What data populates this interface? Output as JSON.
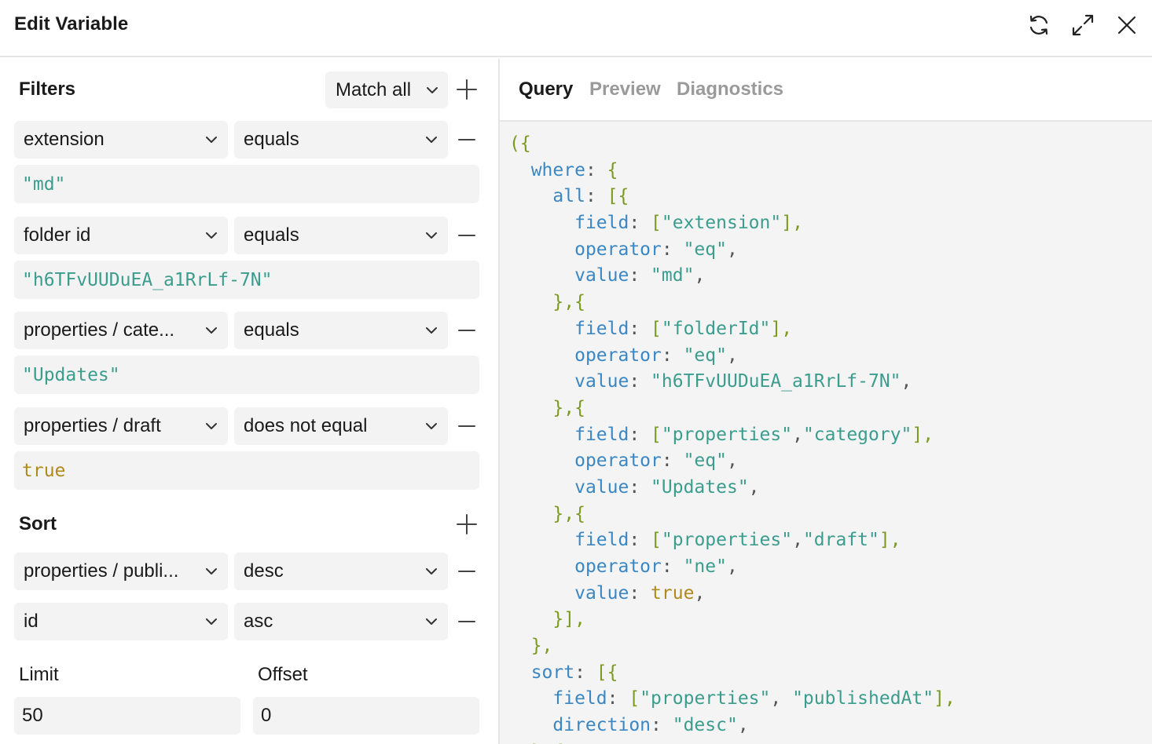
{
  "header": {
    "title": "Edit Variable",
    "icons": [
      "refresh-icon",
      "expand-icon",
      "close-icon"
    ]
  },
  "filters": {
    "title": "Filters",
    "match": "Match all",
    "rows": [
      {
        "field": "extension",
        "operator": "equals",
        "value": "\"md\"",
        "value_type": "string"
      },
      {
        "field": "folder id",
        "operator": "equals",
        "value": "\"h6TFvUUDuEA_a1RrLf-7N\"",
        "value_type": "string"
      },
      {
        "field": "properties / cate...",
        "operator": "equals",
        "value": "\"Updates\"",
        "value_type": "string"
      },
      {
        "field": "properties / draft",
        "operator": "does not equal",
        "value": "true",
        "value_type": "bool"
      }
    ]
  },
  "sort": {
    "title": "Sort",
    "rows": [
      {
        "field": "properties / publi...",
        "direction": "desc"
      },
      {
        "field": "id",
        "direction": "asc"
      }
    ]
  },
  "limit": {
    "label": "Limit",
    "value": "50"
  },
  "offset": {
    "label": "Offset",
    "value": "0"
  },
  "tabs": [
    {
      "label": "Query",
      "active": true
    },
    {
      "label": "Preview",
      "active": false
    },
    {
      "label": "Diagnostics",
      "active": false
    }
  ],
  "code_lines": [
    [
      [
        "p",
        "({"
      ]
    ],
    [
      [
        "c",
        "  "
      ],
      [
        "k",
        "where"
      ],
      [
        "c",
        ": "
      ],
      [
        "p",
        "{"
      ]
    ],
    [
      [
        "c",
        "    "
      ],
      [
        "k",
        "all"
      ],
      [
        "c",
        ": "
      ],
      [
        "p",
        "[{"
      ]
    ],
    [
      [
        "c",
        "      "
      ],
      [
        "k",
        "field"
      ],
      [
        "c",
        ": "
      ],
      [
        "p",
        "["
      ],
      [
        "s",
        "\"extension\""
      ],
      [
        "p",
        "],"
      ]
    ],
    [
      [
        "c",
        "      "
      ],
      [
        "k",
        "operator"
      ],
      [
        "c",
        ": "
      ],
      [
        "s",
        "\"eq\""
      ],
      [
        "c",
        ","
      ]
    ],
    [
      [
        "c",
        "      "
      ],
      [
        "k",
        "value"
      ],
      [
        "c",
        ": "
      ],
      [
        "s",
        "\"md\""
      ],
      [
        "c",
        ","
      ]
    ],
    [
      [
        "c",
        "    "
      ],
      [
        "p",
        "},{"
      ]
    ],
    [
      [
        "c",
        "      "
      ],
      [
        "k",
        "field"
      ],
      [
        "c",
        ": "
      ],
      [
        "p",
        "["
      ],
      [
        "s",
        "\"folderId\""
      ],
      [
        "p",
        "],"
      ]
    ],
    [
      [
        "c",
        "      "
      ],
      [
        "k",
        "operator"
      ],
      [
        "c",
        ": "
      ],
      [
        "s",
        "\"eq\""
      ],
      [
        "c",
        ","
      ]
    ],
    [
      [
        "c",
        "      "
      ],
      [
        "k",
        "value"
      ],
      [
        "c",
        ": "
      ],
      [
        "s",
        "\"h6TFvUUDuEA_a1RrLf-7N\""
      ],
      [
        "c",
        ","
      ]
    ],
    [
      [
        "c",
        "    "
      ],
      [
        "p",
        "},{"
      ]
    ],
    [
      [
        "c",
        "      "
      ],
      [
        "k",
        "field"
      ],
      [
        "c",
        ": "
      ],
      [
        "p",
        "["
      ],
      [
        "s",
        "\"properties\""
      ],
      [
        "c",
        ","
      ],
      [
        "s",
        "\"category\""
      ],
      [
        "p",
        "],"
      ]
    ],
    [
      [
        "c",
        "      "
      ],
      [
        "k",
        "operator"
      ],
      [
        "c",
        ": "
      ],
      [
        "s",
        "\"eq\""
      ],
      [
        "c",
        ","
      ]
    ],
    [
      [
        "c",
        "      "
      ],
      [
        "k",
        "value"
      ],
      [
        "c",
        ": "
      ],
      [
        "s",
        "\"Updates\""
      ],
      [
        "c",
        ","
      ]
    ],
    [
      [
        "c",
        "    "
      ],
      [
        "p",
        "},{"
      ]
    ],
    [
      [
        "c",
        "      "
      ],
      [
        "k",
        "field"
      ],
      [
        "c",
        ": "
      ],
      [
        "p",
        "["
      ],
      [
        "s",
        "\"properties\""
      ],
      [
        "c",
        ","
      ],
      [
        "s",
        "\"draft\""
      ],
      [
        "p",
        "],"
      ]
    ],
    [
      [
        "c",
        "      "
      ],
      [
        "k",
        "operator"
      ],
      [
        "c",
        ": "
      ],
      [
        "s",
        "\"ne\""
      ],
      [
        "c",
        ","
      ]
    ],
    [
      [
        "c",
        "      "
      ],
      [
        "k",
        "value"
      ],
      [
        "c",
        ": "
      ],
      [
        "b",
        "true"
      ],
      [
        "c",
        ","
      ]
    ],
    [
      [
        "c",
        "    "
      ],
      [
        "p",
        "}],"
      ]
    ],
    [
      [
        "c",
        "  "
      ],
      [
        "p",
        "},"
      ]
    ],
    [
      [
        "c",
        "  "
      ],
      [
        "k",
        "sort"
      ],
      [
        "c",
        ": "
      ],
      [
        "p",
        "[{"
      ]
    ],
    [
      [
        "c",
        "    "
      ],
      [
        "k",
        "field"
      ],
      [
        "c",
        ": "
      ],
      [
        "p",
        "["
      ],
      [
        "s",
        "\"properties\""
      ],
      [
        "c",
        ", "
      ],
      [
        "s",
        "\"publishedAt\""
      ],
      [
        "p",
        "],"
      ]
    ],
    [
      [
        "c",
        "    "
      ],
      [
        "k",
        "direction"
      ],
      [
        "c",
        ": "
      ],
      [
        "s",
        "\"desc\""
      ],
      [
        "c",
        ","
      ]
    ],
    [
      [
        "c",
        "  "
      ],
      [
        "p",
        "},{"
      ]
    ]
  ]
}
